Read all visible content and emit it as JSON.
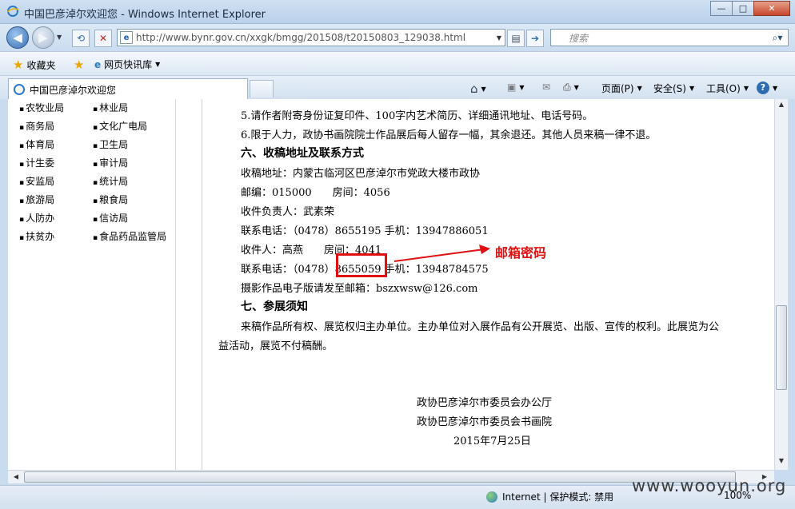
{
  "window": {
    "title": "中国巴彦淖尔欢迎您 - Windows Internet Explorer",
    "minimize": "—",
    "maximize": "□",
    "close": "✕"
  },
  "nav": {
    "back_icon": "arrow-left-icon",
    "forward_icon": "arrow-right-icon",
    "url": "http://www.bynr.gov.cn/xxgk/bmgg/201508/t20150803_129038.html",
    "search_placeholder": "搜索"
  },
  "favorites": {
    "favorites_label": "收藏夹",
    "quick_label": "网页快讯库"
  },
  "tab": {
    "title": "中国巴彦淖尔欢迎您"
  },
  "commands": {
    "page": "页面(P)",
    "safety": "安全(S)",
    "tools": "工具(O)"
  },
  "sidebar": {
    "col1": [
      "农牧业局",
      "商务局",
      "体育局",
      "计生委",
      "安监局",
      "旅游局",
      "人防办",
      "扶贫办"
    ],
    "col2": [
      "林业局",
      "文化广电局",
      "卫生局",
      "审计局",
      "统计局",
      "粮食局",
      "信访局",
      "食品药品监管局"
    ]
  },
  "article": {
    "lines": [
      "5.请作者附寄身份证复印件、100字内艺术简历、详细通讯地址、电话号码。",
      "6.限于人力，政协书画院院士作品展后每人留存一幅，其余退还。其他人员来稿一律不退。",
      "六、收稿地址及联系方式",
      "收稿地址：内蒙古临河区巴彦淖尔市党政大楼市政协",
      "邮编：015000　　房间：4056",
      "收件负责人：武素荣",
      "联系电话：（0478）8655195 手机：13947886051",
      "收件人：高燕　　房间：4041",
      "联系电话：（0478）8655059 手机：13948784575",
      "摄影作品电子版请发至邮箱：bszxwsw@126.com",
      "七、参展须知",
      "来稿作品所有权、展览权归主办单位。主办单位对入展作品有公开展览、出版、宣传的权利。此展览为公",
      "益活动，展览不付稿酬。",
      "政协巴彦淖尔市委员会办公厅",
      "政协巴彦淖尔市委员会书画院",
      "2015年7月25日"
    ],
    "annotation": "邮箱密码"
  },
  "status": {
    "zone": "Internet | 保护模式: 禁用",
    "zoom": "100%",
    "watermark": "www.wooyun.org"
  },
  "colors": {
    "annotation": "#e01010"
  }
}
